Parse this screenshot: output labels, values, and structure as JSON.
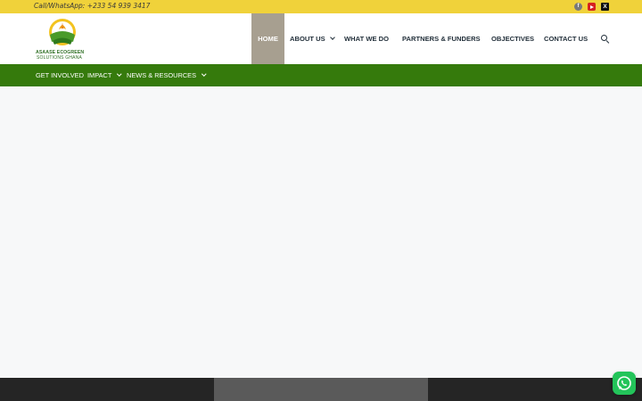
{
  "topbar": {
    "contact": "Call/WhatsApp: +233 54 939 3417",
    "social_icons": [
      "facebook-icon",
      "youtube-icon",
      "x-twitter-icon"
    ]
  },
  "logo": {
    "line1": "ASAASE ECOGREEN",
    "line2": "SOLUTIONS GHANA"
  },
  "nav": {
    "items": [
      {
        "label": "HOME",
        "active": true
      },
      {
        "label": "ABOUT US",
        "dropdown": true
      },
      {
        "label": "WHAT WE DO"
      },
      {
        "label": "PARTNERS & FUNDERS"
      },
      {
        "label": "OBJECTIVES"
      },
      {
        "label": "CONTACT US"
      }
    ],
    "search_icon": "search-icon"
  },
  "subnav": {
    "items": [
      {
        "label": "GET INVOLVED"
      },
      {
        "label": "IMPACT",
        "dropdown": true
      },
      {
        "label": "NEWS & RESOURCES",
        "dropdown": true
      }
    ]
  },
  "colors": {
    "topbar": "#f0d23a",
    "subnav": "#357a0c",
    "nav_active": "#a79f90",
    "whatsapp": "#23c45a"
  },
  "floating": {
    "icon": "whatsapp-icon"
  }
}
